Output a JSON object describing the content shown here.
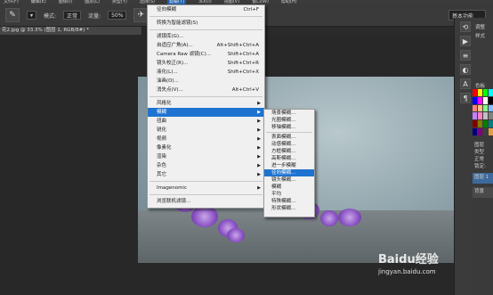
{
  "menubar": {
    "items": [
      "文件(F)",
      "编辑(E)",
      "图像(I)",
      "图层(L)",
      "类型(Y)",
      "选择(S)",
      "滤镜(T)",
      "3D(D)",
      "视图(V)",
      "窗口(W)",
      "帮助(H)"
    ],
    "active_index": 6
  },
  "options": {
    "mode_label": "模式:",
    "mode_value": "正常",
    "opacity_label": "流量:",
    "opacity_value": "50%",
    "workspace": "基本功能"
  },
  "document": {
    "tab_title": "花2.jpg @ 33.3% (图层 1, RGB/8#) *"
  },
  "filter_menu": {
    "items": [
      {
        "label": "径向模糊",
        "shortcut": "Ctrl+F"
      },
      {
        "sep": true
      },
      {
        "label": "转换为智能滤镜(S)",
        "shortcut": ""
      },
      {
        "sep": true
      },
      {
        "label": "滤镜库(G)...",
        "shortcut": ""
      },
      {
        "label": "自适应广角(A)...",
        "shortcut": "Alt+Shift+Ctrl+A"
      },
      {
        "label": "Camera Raw 滤镜(C)...",
        "shortcut": "Shift+Ctrl+A"
      },
      {
        "label": "镜头校正(R)...",
        "shortcut": "Shift+Ctrl+R"
      },
      {
        "label": "液化(L)...",
        "shortcut": "Shift+Ctrl+X"
      },
      {
        "label": "油画(O)...",
        "shortcut": ""
      },
      {
        "label": "消失点(V)...",
        "shortcut": "Alt+Ctrl+V"
      },
      {
        "sep": true
      },
      {
        "label": "风格化",
        "submenu": true
      },
      {
        "label": "模糊",
        "submenu": true,
        "highlight": true
      },
      {
        "label": "扭曲",
        "submenu": true
      },
      {
        "label": "锐化",
        "submenu": true
      },
      {
        "label": "视频",
        "submenu": true
      },
      {
        "label": "像素化",
        "submenu": true
      },
      {
        "label": "渲染",
        "submenu": true
      },
      {
        "label": "杂色",
        "submenu": true
      },
      {
        "label": "其它",
        "submenu": true
      },
      {
        "sep": true
      },
      {
        "label": "Imagenomic",
        "submenu": true
      },
      {
        "sep": true
      },
      {
        "label": "浏览联机滤镜...",
        "shortcut": ""
      }
    ]
  },
  "blur_submenu": {
    "items": [
      {
        "label": "场景模糊..."
      },
      {
        "label": "光圈模糊..."
      },
      {
        "label": "移轴模糊..."
      },
      {
        "sep": true
      },
      {
        "label": "表面模糊..."
      },
      {
        "label": "动感模糊..."
      },
      {
        "label": "方框模糊..."
      },
      {
        "label": "高斯模糊..."
      },
      {
        "label": "进一步模糊"
      },
      {
        "label": "径向模糊...",
        "highlight": true
      },
      {
        "label": "镜头模糊..."
      },
      {
        "label": "模糊"
      },
      {
        "label": "平均"
      },
      {
        "label": "特殊模糊..."
      },
      {
        "label": "形状模糊..."
      }
    ]
  },
  "right_panels": {
    "adjust_label": "调整",
    "style_label": "样式",
    "swatch_label": "色板",
    "layers_label": "图层",
    "kind_label": "类型",
    "normal_label": "正常",
    "lock_label": "锁定:",
    "layer_names": [
      "图层 1",
      "背景"
    ]
  },
  "swatch_colors": [
    "#ff0000",
    "#ffff00",
    "#00ff00",
    "#00ffff",
    "#0000ff",
    "#ff00ff",
    "#ffffff",
    "#000000",
    "#ff8080",
    "#ffc080",
    "#80ff80",
    "#80c0ff",
    "#c080ff",
    "#ff80c0",
    "#c0c0c0",
    "#808080",
    "#800000",
    "#808000",
    "#008000",
    "#008080",
    "#000080",
    "#800080",
    "#404040",
    "#e0a040"
  ],
  "watermark": {
    "line1": "Baidu经验",
    "line2": "jingyan.baidu.com"
  }
}
